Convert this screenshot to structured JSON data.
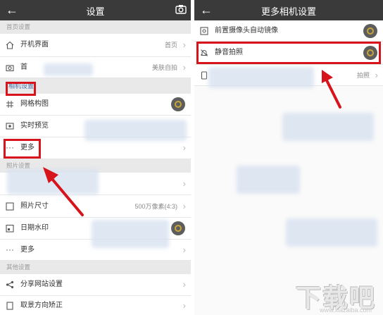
{
  "left": {
    "title": "设置",
    "sections": {
      "home": "首页设置",
      "photo": "照片设置",
      "other": "其他设置"
    },
    "rows": {
      "open_screen": {
        "label": "开机界面",
        "value": "首页"
      },
      "home_entry": {
        "label": "首",
        "value": "美肤自拍"
      },
      "camera_settings_partial": {
        "label": "相机设置"
      },
      "grid": {
        "label": "网格构图"
      },
      "live_preview": {
        "label": "实时预览"
      },
      "more": {
        "label": "更多"
      },
      "photo_size": {
        "label": "照片尺寸",
        "value": "500万像素(4:3)"
      },
      "date_watermark": {
        "label": "日期水印"
      },
      "more2": {
        "label": "更多"
      },
      "share_sites": {
        "label": "分享网站设置"
      },
      "orientation": {
        "label": "取景方向矫正"
      }
    }
  },
  "right": {
    "title": "更多相机设置",
    "rows": {
      "mirror": {
        "label": "前置摄像头自动镜像"
      },
      "silent": {
        "label": "静音拍照"
      },
      "shutter": {
        "value": "拍照"
      }
    }
  },
  "watermark": {
    "text": "下载吧",
    "sub": "www.xiazaiba.com"
  },
  "colors": {
    "highlight": "#d7141b",
    "titlebar": "#3a3a3a",
    "toggle_ring": "#c9a43a"
  }
}
